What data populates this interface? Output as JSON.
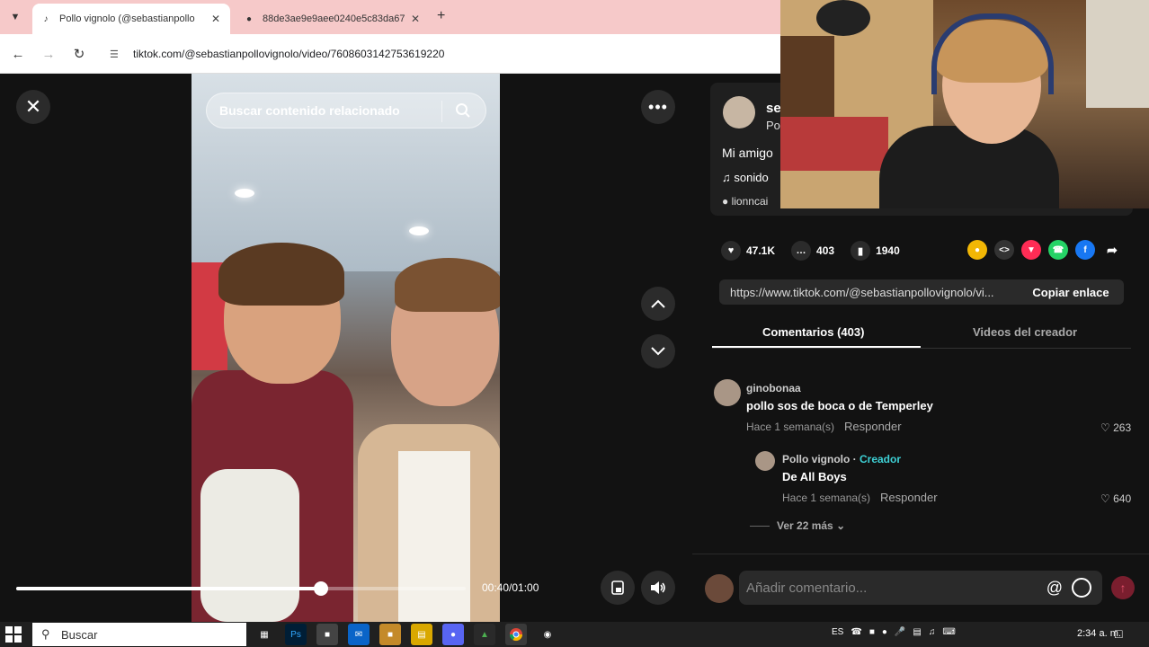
{
  "browser": {
    "tabs": [
      {
        "title": "Pollo vignolo (@sebastianpollo",
        "favicon": "tiktok-icon",
        "active": true
      },
      {
        "title": "88de3ae9e9aee0240e5c83da67",
        "favicon": "globe-icon",
        "active": false
      }
    ],
    "url": "tiktok.com/@sebastianpollovignolo/video/7608603142753619220"
  },
  "video": {
    "search_placeholder": "Buscar contenido relacionado",
    "time": "00:40/01:00",
    "progress_fraction": 0.677
  },
  "panel": {
    "creator_name": "se",
    "creator_sub": "Po",
    "caption": "Mi amigo",
    "sound": "sonido",
    "tagged": "lionncai",
    "likes": "47.1K",
    "comments_count": "403",
    "saves": "1940",
    "link": "https://www.tiktok.com/@sebastianpollovignolo/vi...",
    "copy_link": "Copiar enlace",
    "tab_comments": "Comentarios (403)",
    "tab_videos": "Videos del creador",
    "comments": [
      {
        "user": "ginobonaa",
        "text": "pollo sos de boca o de Temperley",
        "time": "Hace 1 semana(s)",
        "reply": "Responder",
        "likes": "263"
      },
      {
        "user": "Pollo vignolo",
        "creator_tag": "Creador",
        "text": "De All Boys",
        "time": "Hace 1 semana(s)",
        "reply": "Responder",
        "likes": "640"
      }
    ],
    "view_more": "Ver 22 más",
    "add_comment_placeholder": "Añadir comentario..."
  },
  "taskbar": {
    "search": "Buscar",
    "language": "ES",
    "time": "2:34 a. m."
  },
  "colors": {
    "tab_bar": "#f6c9c9",
    "page_bg": "#121212",
    "creator_tag": "#3ed1d6",
    "send_button": "#7a1e2e"
  }
}
